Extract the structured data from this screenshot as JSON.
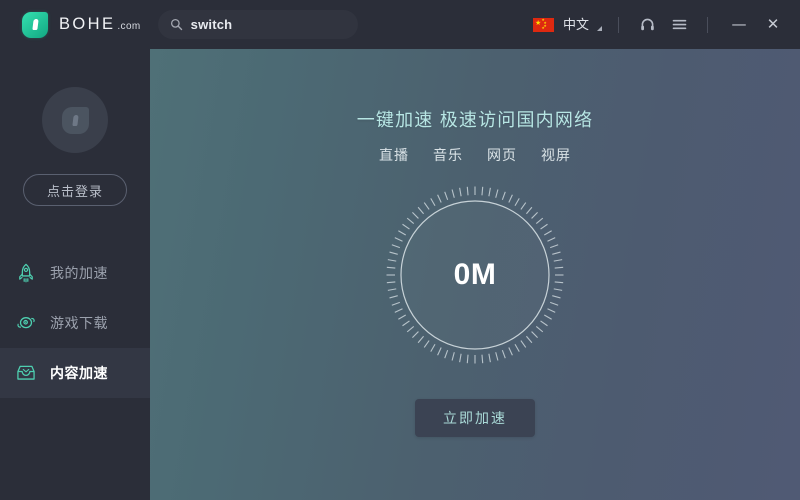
{
  "titlebar": {
    "brand_name": "BOHE",
    "brand_suffix": ".com",
    "logo_icon": "shield-drop-logo",
    "search": {
      "value": "switch",
      "placeholder": "switch",
      "icon": "search-icon"
    },
    "language": {
      "label": "中文",
      "flag": "china-flag-icon",
      "caret": "dropdown-caret-icon"
    },
    "support_icon": "headset-icon",
    "menu_icon": "hamburger-menu-icon",
    "minimize_label": "—",
    "close_label": "✕"
  },
  "sidebar": {
    "avatar_icon": "user-avatar-logo",
    "login_label": "点击登录",
    "items": [
      {
        "label": "我的加速",
        "icon": "rocket-icon",
        "active": false
      },
      {
        "label": "游戏下载",
        "icon": "gamepad-icon",
        "active": false
      },
      {
        "label": "内容加速",
        "icon": "inbox-box-icon",
        "active": true
      }
    ]
  },
  "main": {
    "headline": "一键加速 极速访问国内网络",
    "categories": [
      "直播",
      "音乐",
      "网页",
      "视屏"
    ],
    "gauge": {
      "value": "0M",
      "ticks": 72
    },
    "action_label": "立即加速"
  },
  "colors": {
    "brand_green": "#25c79b",
    "accent_teal": "#b7e6e4",
    "sidebar_bg": "#2b2e39",
    "active_item_bg": "#333744",
    "main_gradient_start": "#4f7077",
    "main_gradient_end": "#505a74",
    "flag_red": "#de2910",
    "flag_yellow": "#ffde00"
  }
}
